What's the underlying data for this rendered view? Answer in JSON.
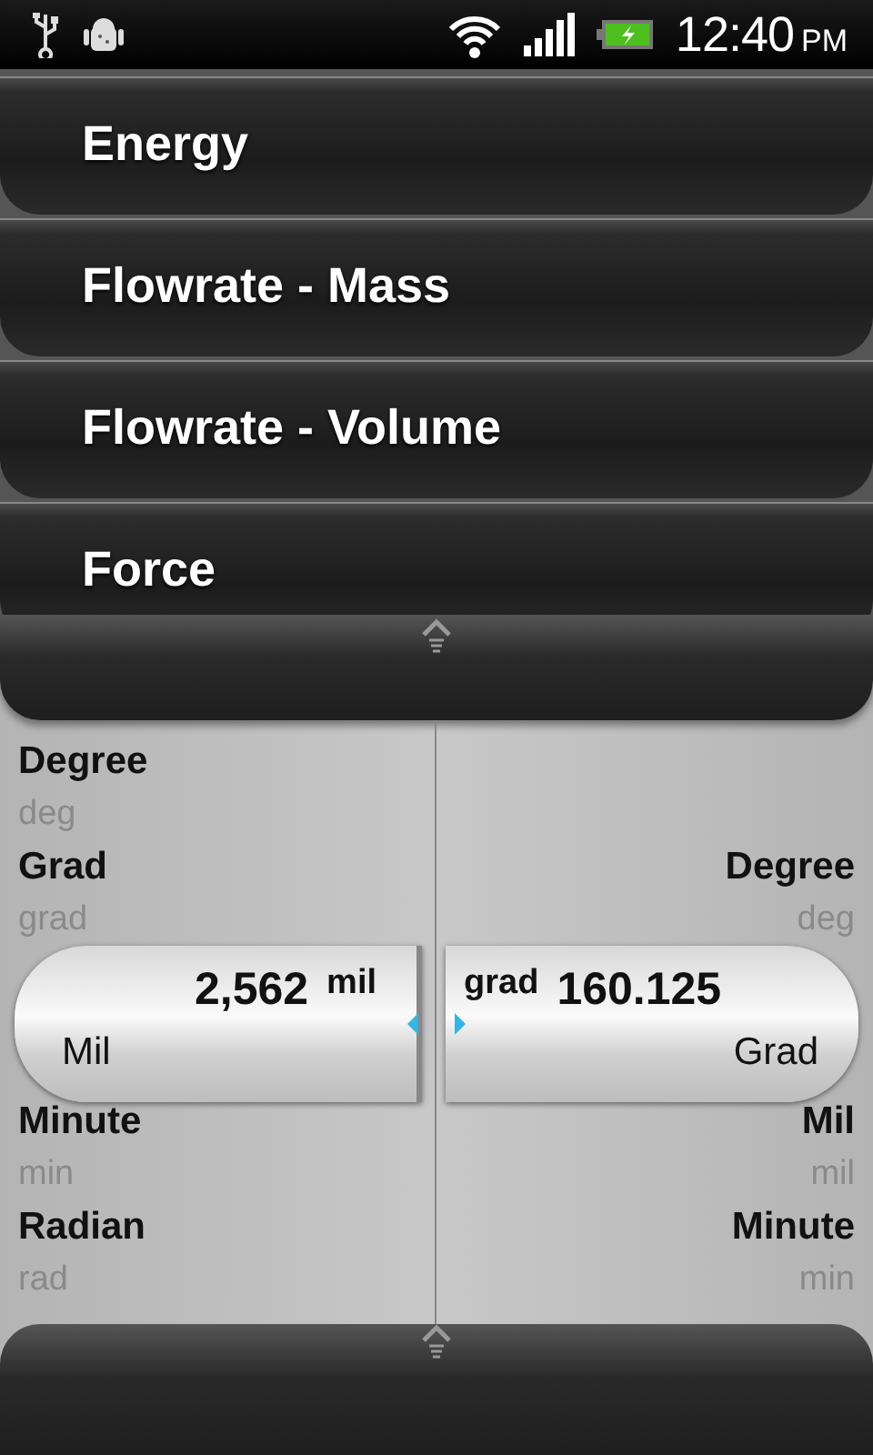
{
  "status_bar": {
    "time": "12:40",
    "meridiem": "PM"
  },
  "categories": [
    {
      "label": "Energy"
    },
    {
      "label": "Flowrate - Mass"
    },
    {
      "label": "Flowrate - Volume"
    },
    {
      "label": "Force"
    }
  ],
  "from_units": {
    "items_before": [
      {
        "name": "Degree",
        "unit": "deg"
      },
      {
        "name": "Grad",
        "unit": "grad"
      }
    ],
    "selected": {
      "value": "2,562",
      "unit": "mil",
      "name": "Mil"
    },
    "items_after": [
      {
        "name": "Minute",
        "unit": "min"
      },
      {
        "name": "Radian",
        "unit": "rad"
      }
    ]
  },
  "to_units": {
    "items_before": [
      {
        "name": "Degree",
        "unit": "deg"
      }
    ],
    "selected": {
      "value": "160.125",
      "unit": "grad",
      "name": "Grad"
    },
    "items_after": [
      {
        "name": "Mil",
        "unit": "mil"
      },
      {
        "name": "Minute",
        "unit": "min"
      }
    ]
  }
}
